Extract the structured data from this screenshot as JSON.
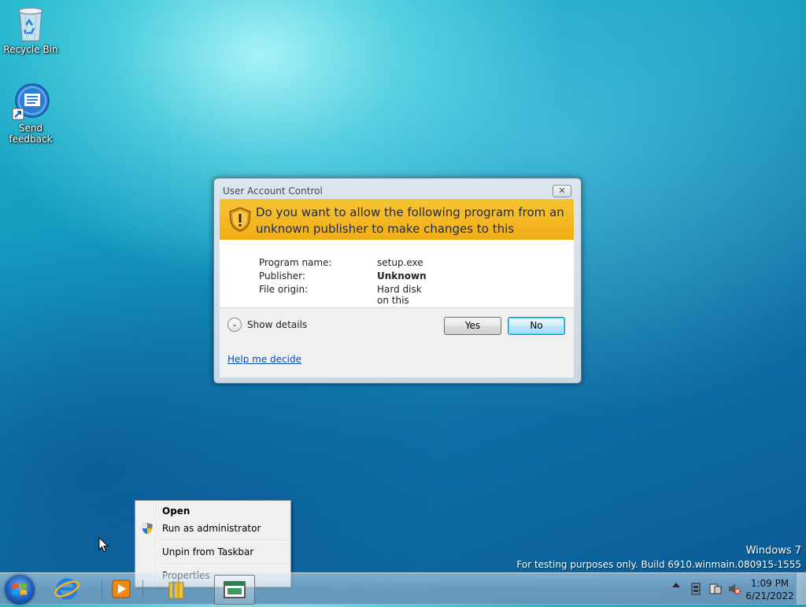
{
  "desktop": {
    "icons": [
      {
        "label": "Recycle Bin"
      },
      {
        "label_line1": "Send",
        "label_line2": "feedback"
      }
    ],
    "watermark": {
      "line1": "Windows  7",
      "line2": "For testing purposes only. Build 6910.winmain.080915-1555"
    }
  },
  "uac": {
    "title": "User Account Control",
    "question_line1": "Do you want to allow the following program from an",
    "question_line2": "unknown publisher to make changes to this computer?",
    "fields": [
      {
        "label": "Program name:",
        "value": "setup.exe"
      },
      {
        "label": "Publisher:",
        "value": "Unknown"
      },
      {
        "label": "File origin:",
        "value": "Hard disk on this computer"
      }
    ],
    "show_details": "Show details",
    "yes": "Yes",
    "no": "No",
    "help_link": "Help me decide",
    "close_glyph": "✕",
    "chevron_glyph": "⌄",
    "banner_color": "#f3b321"
  },
  "context_menu": {
    "items": [
      "Open",
      "Run as administrator",
      "Unpin from Taskbar",
      "Properties"
    ]
  },
  "taskbar": {
    "time": "1:09 PM",
    "date": "6/21/2022"
  }
}
